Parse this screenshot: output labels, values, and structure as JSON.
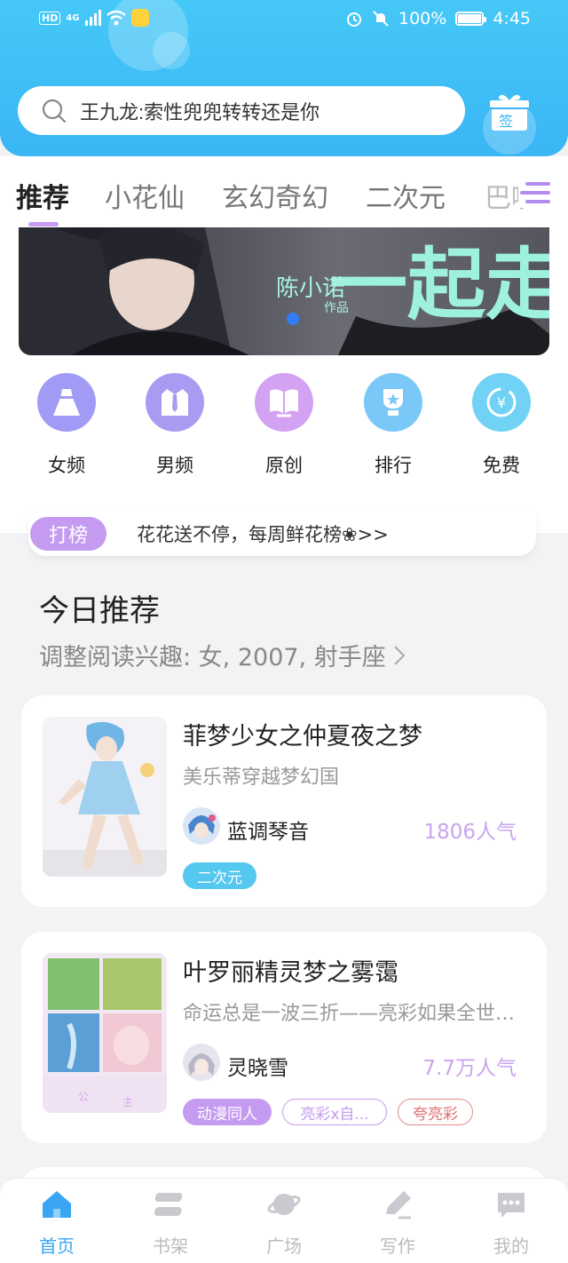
{
  "status_bar": {
    "hd": "HD",
    "signal": "4G",
    "battery_percent": "100%",
    "time": "4:45"
  },
  "search": {
    "placeholder": "王九龙:索性兜兜转转还是你",
    "gift_label": "签"
  },
  "tabs": [
    {
      "label": "推荐",
      "active": true
    },
    {
      "label": "小花仙",
      "active": false
    },
    {
      "label": "玄幻奇幻",
      "active": false
    },
    {
      "label": "二次元",
      "active": false
    },
    {
      "label": "巴啦",
      "active": false
    }
  ],
  "banner": {
    "author_text": "陈小诺",
    "work_text": "作品",
    "title_text": "一起走"
  },
  "categories": [
    {
      "label": "女频",
      "icon": "dress-icon",
      "color": "#9f9af5"
    },
    {
      "label": "男频",
      "icon": "shirt-icon",
      "color": "#a79cf2"
    },
    {
      "label": "原创",
      "icon": "book-icon",
      "color": "#d3a2f3"
    },
    {
      "label": "排行",
      "icon": "trophy-icon",
      "color": "#7ac8f7"
    },
    {
      "label": "免费",
      "icon": "yuan-icon",
      "color": "#71d2f5"
    }
  ],
  "rank_bar": {
    "badge": "打榜",
    "text": "花花送不停，每周鲜花榜❀>>"
  },
  "today": {
    "title": "今日推荐",
    "subtitle": "调整阅读兴趣: 女, 2007, 射手座"
  },
  "books": [
    {
      "title": "菲梦少女之仲夏夜之梦",
      "desc": "美乐蒂穿越梦幻国",
      "author": "蓝调琴音",
      "popularity": "1806人气",
      "tags": [
        {
          "label": "二次元",
          "style": "filled-blue"
        }
      ]
    },
    {
      "title": "叶罗丽精灵梦之雾霭",
      "desc": "命运总是一波三折——亮彩如果全世界都...",
      "author": "灵晓雪",
      "popularity": "7.7万人气",
      "tags": [
        {
          "label": "动漫同人",
          "style": "filled-purple"
        },
        {
          "label": "亮彩x自...",
          "style": "outline-purple"
        },
        {
          "label": "夸亮彩",
          "style": "outline-red"
        }
      ]
    }
  ],
  "bottom_nav": [
    {
      "label": "首页",
      "icon": "home-icon",
      "active": true
    },
    {
      "label": "书架",
      "icon": "bookshelf-icon",
      "active": false
    },
    {
      "label": "广场",
      "icon": "planet-icon",
      "active": false
    },
    {
      "label": "写作",
      "icon": "pen-icon",
      "active": false
    },
    {
      "label": "我的",
      "icon": "chat-bubble-icon",
      "active": false
    }
  ],
  "colors": {
    "header": "#3ab6f5",
    "accent_purple": "#c49bf0",
    "accent_blue": "#3aa6f3",
    "popularity": "#c9a4ee"
  }
}
